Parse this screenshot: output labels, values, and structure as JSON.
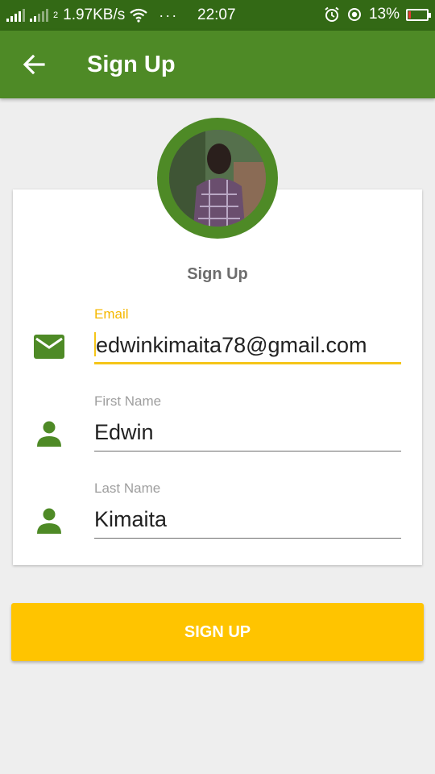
{
  "status_bar": {
    "network_speed": "1.97KB/s",
    "more": "···",
    "time": "22:07",
    "battery": "13%",
    "battery_level": 0.13,
    "sim_label": "2"
  },
  "app_bar": {
    "title": "Sign Up",
    "back_icon": "arrow-back-icon",
    "color": "#4e8a26"
  },
  "avatar": {
    "icon": "profile-photo"
  },
  "form": {
    "heading": "Sign Up",
    "fields": [
      {
        "label": "Email",
        "value": "edwinkimaita78@gmail.com",
        "icon": "mail-icon",
        "focused": true
      },
      {
        "label": "First Name",
        "value": "Edwin",
        "icon": "person-icon",
        "focused": false
      },
      {
        "label": "Last Name",
        "value": "Kimaita",
        "icon": "person-icon",
        "focused": false
      }
    ]
  },
  "submit": {
    "label": "SIGN UP",
    "color": "#ffc400"
  },
  "colors": {
    "primary_dark": "#336915",
    "primary": "#4e8a26",
    "accent": "#ffc400"
  }
}
